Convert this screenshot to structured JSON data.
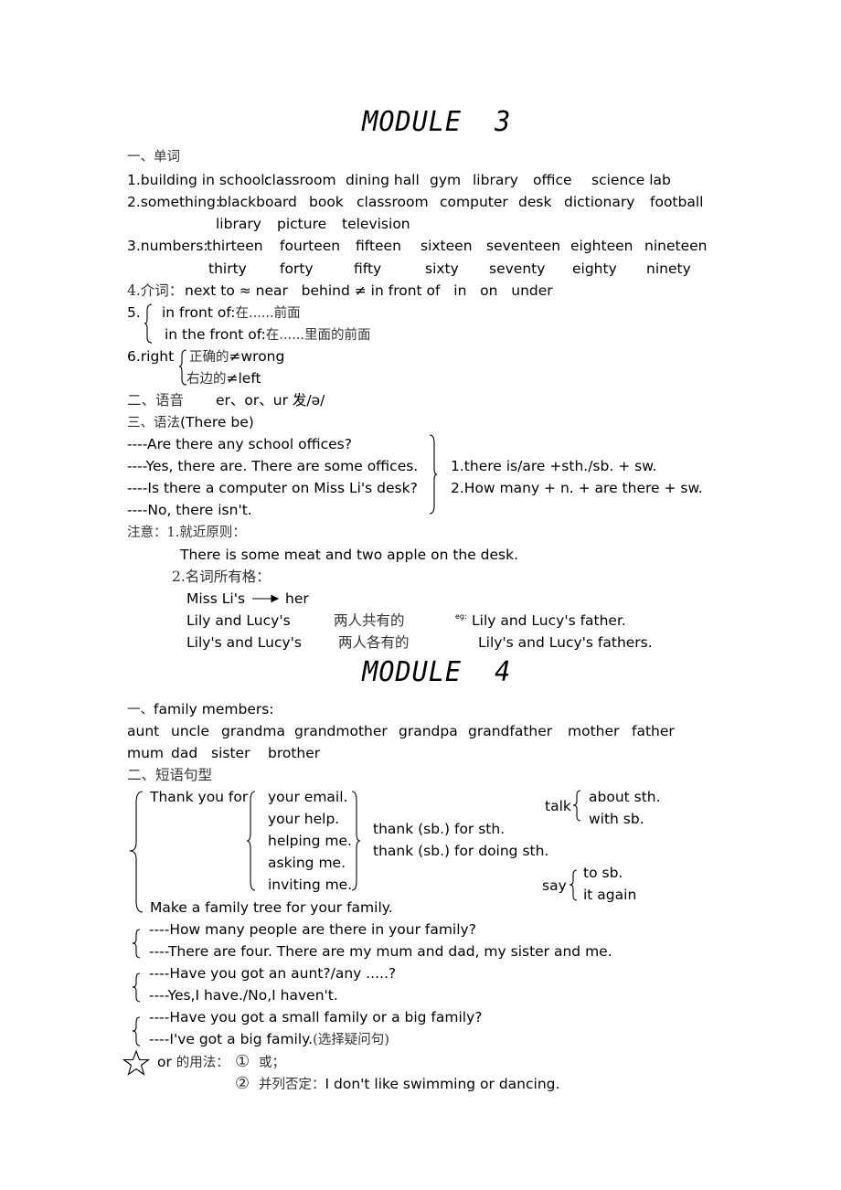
{
  "module3": {
    "title": "MODULE  3",
    "vocab_heading": "一、单词",
    "vocab": [
      {
        "label": "1.building in school:",
        "words": [
          "classroom",
          "dining hall",
          "gym",
          "library",
          "office",
          "science lab"
        ]
      },
      {
        "label": "2.something:",
        "words": [
          "blackboard",
          "book",
          "classroom",
          "computer",
          "desk",
          "dictionary",
          "football"
        ],
        "words_line2": [
          "library",
          "picture",
          "television"
        ]
      },
      {
        "label": "3.numbers:",
        "words": [
          "thirteen",
          "fourteen",
          "fifteen",
          "sixteen",
          "seventeen",
          "eighteen",
          "nineteen"
        ],
        "words_line2": [
          "thirty",
          "forty",
          "fifty",
          "sixty",
          "seventy",
          "eighty",
          "ninety"
        ]
      }
    ],
    "prep_prefix": "4.介词：",
    "prep_text": "next to ≈ near   behind ≠ in front of   in   on   under",
    "item5_label": "5.",
    "item5_lines": [
      {
        "en": "in front of:",
        "cn": "在......前面"
      },
      {
        "en": "in the front of:",
        "cn": "在......里面的前面"
      }
    ],
    "item6_label": "6.right",
    "item6_lines": [
      {
        "cn": "正确的",
        "en": "≠wrong"
      },
      {
        "cn": "右边的",
        "en": "≠left"
      }
    ],
    "phonics_prefix": "二、语音",
    "phonics_text": "er、or、ur 发/ə/",
    "grammar_prefix": "三、语法",
    "grammar_text": "(There be)",
    "dialogue": [
      "----Are there any school offices?",
      "----Yes, there are. There are some offices.",
      "----Is there a computer on Miss Li's desk?",
      "----No, there isn't."
    ],
    "patterns": [
      "1.there is/are +sth./sb. + sw.",
      "2.How many + n. + are there + sw."
    ],
    "note_prefix": "注意：",
    "note1_label": "1.就近原则：",
    "note1_example": "There is some meat and two apple on the desk.",
    "note2_label": "2.名词所有格：",
    "possessive_from": "Miss Li's",
    "possessive_to": "her",
    "possessive_rows": [
      {
        "form": "Lily and Lucy's",
        "meaning": "两人共有的",
        "eg_label": "eg:",
        "example": "Lily and Lucy's father."
      },
      {
        "form": "Lily's and Lucy's",
        "meaning": "两人各有的",
        "eg_label": "",
        "example": "Lily's and Lucy's fathers."
      }
    ]
  },
  "module4": {
    "title": "MODULE  4",
    "family_prefix": "一、",
    "family_heading": "family members:",
    "family_words_line1": [
      "aunt",
      "uncle",
      "grandma",
      "grandmother",
      "grandpa",
      "grandfather",
      "mother",
      "father"
    ],
    "family_words_line2": [
      "mum",
      "dad",
      "sister",
      "brother"
    ],
    "phrases_heading": "二、短语句型",
    "thank_you_for": "Thank you for",
    "thank_objects": [
      "your email.",
      "your help.",
      "helping me.",
      "asking me.",
      "inviting me."
    ],
    "thank_patterns": [
      "thank (sb.) for sth.",
      "thank (sb.) for doing sth."
    ],
    "talk_label": "talk",
    "talk_items": [
      "about sth.",
      "with sb."
    ],
    "say_label": "say",
    "say_items": [
      "to sb.",
      "it again"
    ],
    "family_tree": "Make a family tree for your family.",
    "dialogues": [
      [
        "----How many people are there in your family?",
        "----There are four. There are my mum and dad, my sister and me."
      ],
      [
        "----Have you got an aunt?/any .....?",
        "----Yes,I have./No,I haven't."
      ],
      [
        "----Have you got a small family or a big family?",
        "----I've got a big family."
      ]
    ],
    "dialogue3_note": "(选择疑问句)",
    "or_label": "or",
    "or_usage_heading": "的用法：",
    "or_usages": [
      {
        "num": "①",
        "text_cn": "或；",
        "text_en": ""
      },
      {
        "num": "②",
        "text_cn": "并列否定：",
        "text_en": "I don't like swimming or dancing."
      }
    ]
  }
}
